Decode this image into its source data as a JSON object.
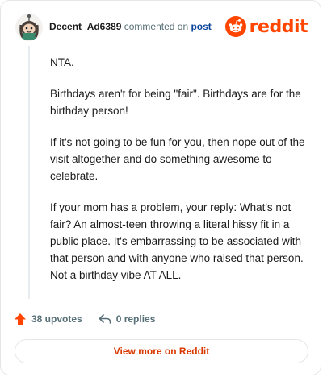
{
  "header": {
    "username": "Decent_Ad6389",
    "commented_text": "commented on",
    "post_link": "post",
    "brand_name": "reddit",
    "avatar_icon": "snoo-avatar-icon",
    "brand_icon": "reddit-alien-icon"
  },
  "comment": {
    "paragraphs": [
      "NTA.",
      "Birthdays aren't for being \"fair\". Birthdays are for the birthday person!",
      "If it's not going to be fun for you, then nope out of the visit altogether and do something awesome to celebrate.",
      "If your mom has a problem, your reply: What's not fair? An almost-teen throwing a literal hissy fit in a public place. It's embarrassing to be associated with that person and with anyone who raised that person. Not a birthday vibe AT ALL."
    ]
  },
  "actions": {
    "upvotes": "38 upvotes",
    "replies": "0 replies",
    "upvote_icon": "upvote-arrow-icon",
    "reply_icon": "reply-arrow-icon"
  },
  "footer": {
    "view_more": "View more on Reddit"
  },
  "colors": {
    "brand": "#ff4500",
    "link": "#0a449b",
    "muted": "#576f76",
    "view_more": "#d93900"
  }
}
